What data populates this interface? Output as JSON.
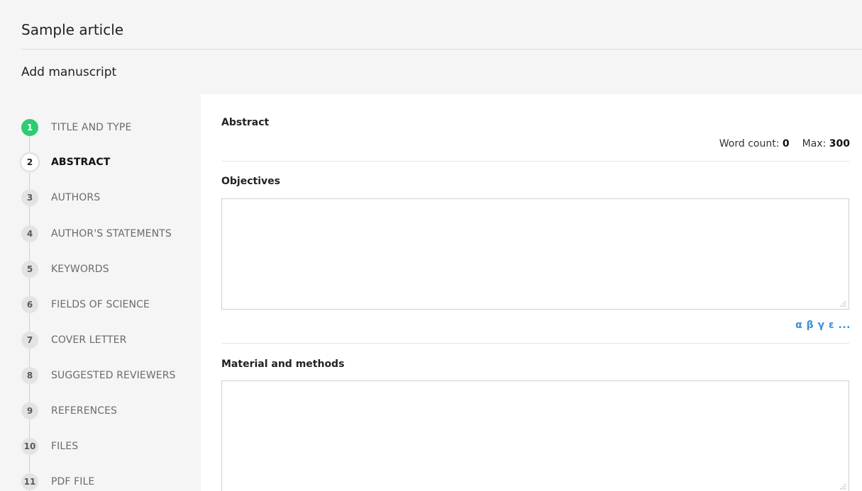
{
  "header": {
    "article_title": "Sample article",
    "section_title": "Add manuscript"
  },
  "steps": [
    {
      "number": "1",
      "label": "TITLE AND TYPE",
      "state": "done"
    },
    {
      "number": "2",
      "label": "ABSTRACT",
      "state": "active"
    },
    {
      "number": "3",
      "label": "AUTHORS",
      "state": "pending"
    },
    {
      "number": "4",
      "label": "AUTHOR'S STATEMENTS",
      "state": "pending"
    },
    {
      "number": "5",
      "label": "KEYWORDS",
      "state": "pending"
    },
    {
      "number": "6",
      "label": "FIELDS OF SCIENCE",
      "state": "pending"
    },
    {
      "number": "7",
      "label": "COVER LETTER",
      "state": "pending"
    },
    {
      "number": "8",
      "label": "SUGGESTED REVIEWERS",
      "state": "pending"
    },
    {
      "number": "9",
      "label": "REFERENCES",
      "state": "pending"
    },
    {
      "number": "10",
      "label": "FILES",
      "state": "pending"
    },
    {
      "number": "11",
      "label": "PDF FILE",
      "state": "pending"
    }
  ],
  "abstract": {
    "heading": "Abstract",
    "word_count_label": "Word count:",
    "word_count_value": "0",
    "max_label": "Max:",
    "max_value": "300",
    "greek_symbols_link": "α β γ ε ...",
    "fields": [
      {
        "label": "Objectives",
        "value": ""
      },
      {
        "label": "Material and methods",
        "value": ""
      }
    ]
  },
  "colors": {
    "done_step": "#2ecc71",
    "link": "#3a8fd6"
  }
}
